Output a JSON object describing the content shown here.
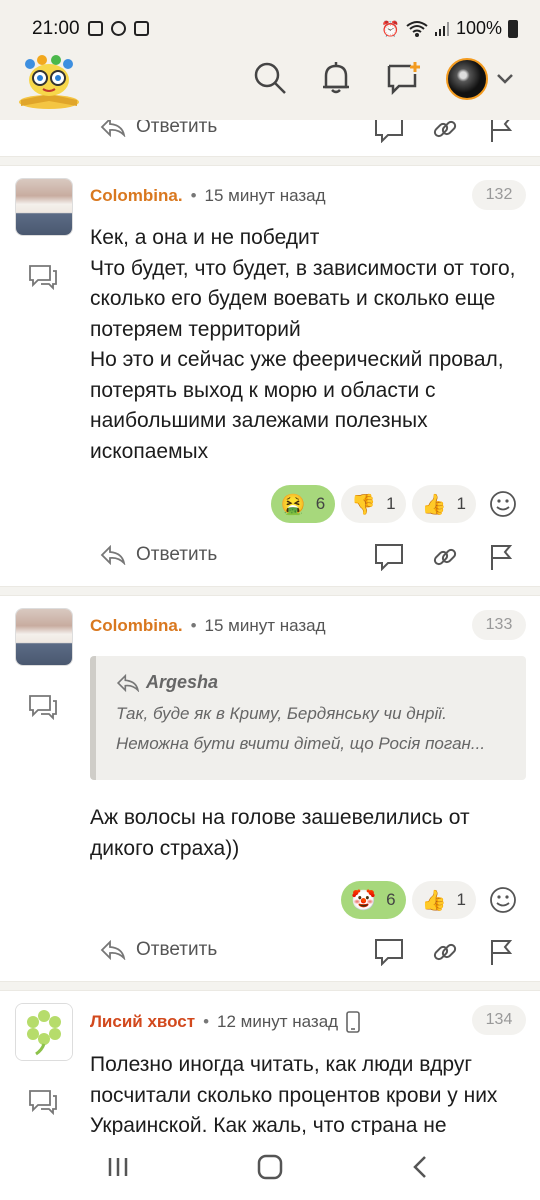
{
  "status_bar": {
    "time": "21:00",
    "battery": "100%"
  },
  "feed": {
    "top_actions": {
      "reply_label": "Ответить"
    },
    "comments": [
      {
        "author": "Colombina.",
        "separator": "•",
        "time": "15 минут назад",
        "number": "132",
        "text": "Кек, а она и не победит\nЧто будет, что будет, в зависимости от того, сколько его будем воевать и сколько еще потеряем территорий\nНо это и сейчас уже феерический провал, потерять выход к морю и области с наибольшими залежами полезных ископаемых",
        "reactions": [
          {
            "emoji": "🤮",
            "count": "6",
            "active": true
          },
          {
            "emoji": "👎",
            "count": "1",
            "active": false
          },
          {
            "emoji": "👍",
            "count": "1",
            "active": false
          }
        ],
        "reply_label": "Ответить"
      },
      {
        "author": "Colombina.",
        "separator": "•",
        "time": "15 минут назад",
        "number": "133",
        "quote": {
          "author": "Argesha",
          "line1": "Так, буде як в Криму, Бердянську чи днрії.",
          "line2": "Неможна бути вчити дітей, що Росія поган..."
        },
        "text": "Аж волосы на голове зашевелились от дикого страха))",
        "reactions": [
          {
            "emoji": "🤡",
            "count": "6",
            "active": true
          },
          {
            "emoji": "👍",
            "count": "1",
            "active": false
          }
        ],
        "reply_label": "Ответить"
      },
      {
        "author": "Лисий хвост",
        "separator": "•",
        "time": "12 минут назад",
        "number": "134",
        "text": "Полезно иногда читать, как люди вдруг посчитали сколько процентов крови у них Украинской. Как жаль, что страна не"
      }
    ]
  },
  "icons": {
    "accent_orange": "#f39b1f",
    "reaction_active": "#a7d87c"
  }
}
